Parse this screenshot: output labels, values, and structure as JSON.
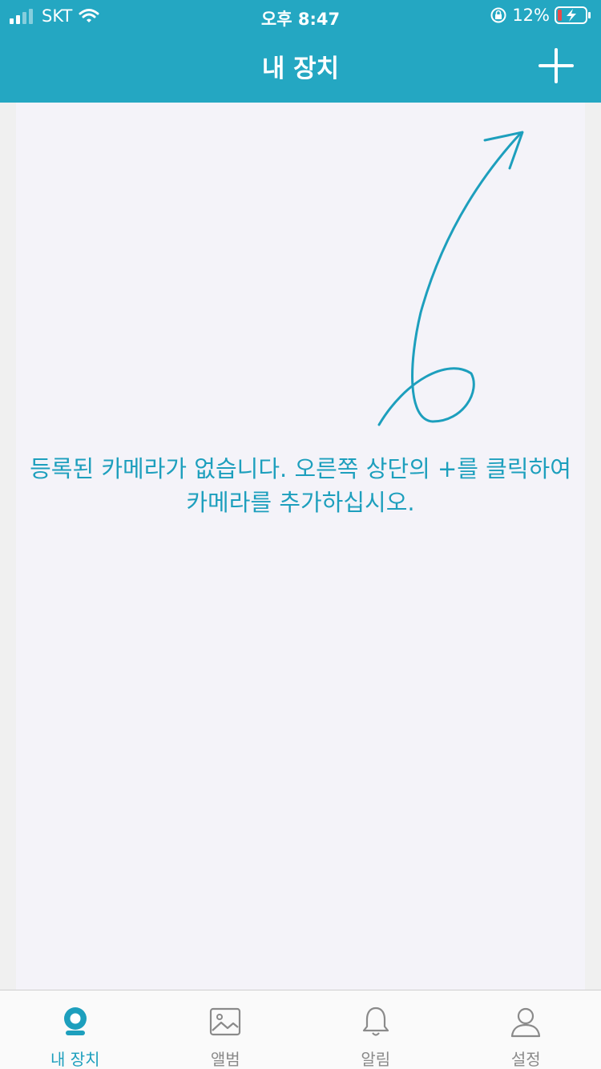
{
  "status_bar": {
    "carrier": "SKT",
    "time": "오후 8:47",
    "battery_percent": "12%"
  },
  "nav": {
    "title": "내 장치",
    "add_icon": "plus-icon"
  },
  "empty_state": {
    "message": "등록된 카메라가 없습니다. 오른쪽 상단의 +를 클릭하여 카메라를 추가하십시오.",
    "arrow_icon": "hand-drawn-arrow-icon"
  },
  "tabs": [
    {
      "label": "내 장치",
      "icon": "camera-icon",
      "active": true
    },
    {
      "label": "앨범",
      "icon": "picture-icon",
      "active": false
    },
    {
      "label": "알림",
      "icon": "bell-icon",
      "active": false
    },
    {
      "label": "설정",
      "icon": "user-icon",
      "active": false
    }
  ],
  "colors": {
    "accent": "#24a7c2",
    "text_accent": "#1d9fbd",
    "tab_inactive": "#8a8a8a",
    "content_bg": "#f4f3f9"
  }
}
